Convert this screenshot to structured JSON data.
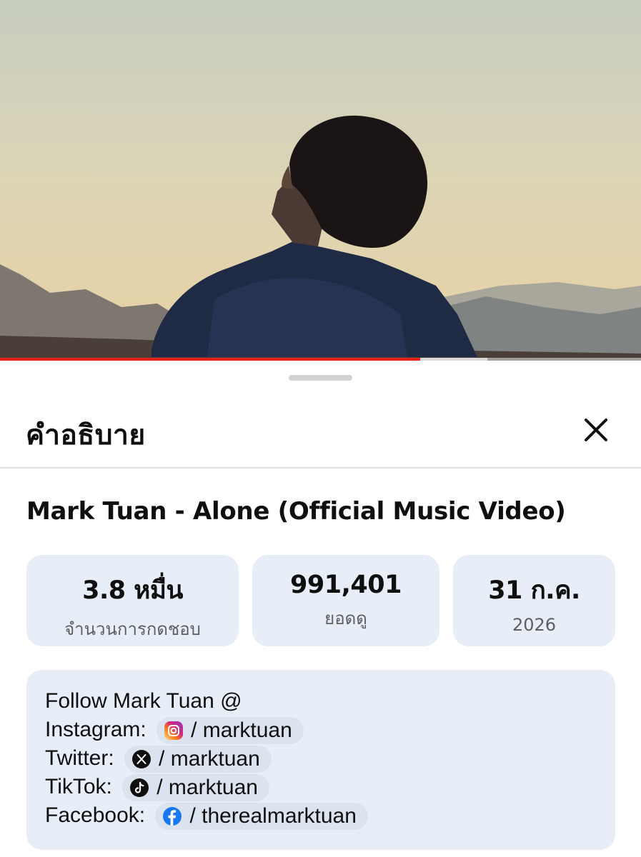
{
  "video": {
    "progress_percent": 65.5,
    "buffered_percent": 76
  },
  "sheet": {
    "title": "คำอธิบาย",
    "close_icon": "close-icon"
  },
  "video_title": "Mark Tuan - Alone (Official Music Video)",
  "stats": [
    {
      "value": "3.8 หมื่น",
      "label": "จำนวนการกดชอบ"
    },
    {
      "value": "991,401",
      "label": "ยอดดู"
    },
    {
      "value": "31 ก.ค.",
      "label": "2026"
    }
  ],
  "description": {
    "intro": "Follow Mark Tuan @",
    "links": [
      {
        "label": "Instagram:",
        "icon": "instagram-icon",
        "handle": "/ marktuan"
      },
      {
        "label": "Twitter:",
        "icon": "x-icon",
        "handle": "/ marktuan"
      },
      {
        "label": "TikTok:",
        "icon": "tiktok-icon",
        "handle": "/ marktuan"
      },
      {
        "label": "Facebook:",
        "icon": "facebook-icon",
        "handle": "/ therealmarktuan"
      }
    ]
  },
  "colors": {
    "progress": "#e62117",
    "card_bg": "#e7eef8",
    "chip_bg": "#dbe3ee",
    "facebook": "#1877f2"
  }
}
